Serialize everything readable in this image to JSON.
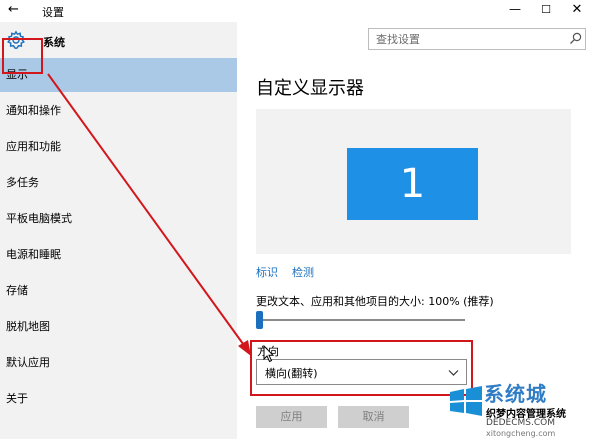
{
  "window": {
    "title": "设置",
    "back_glyph": "←",
    "minimize_glyph": "—",
    "maximize_glyph": "☐",
    "close_glyph": "✕"
  },
  "sidebar": {
    "title": "系统",
    "items": [
      {
        "label": "显示",
        "active": true
      },
      {
        "label": "通知和操作"
      },
      {
        "label": "应用和功能"
      },
      {
        "label": "多任务"
      },
      {
        "label": "平板电脑模式"
      },
      {
        "label": "电源和睡眠"
      },
      {
        "label": "存储"
      },
      {
        "label": "脱机地图"
      },
      {
        "label": "默认应用"
      },
      {
        "label": "关于"
      }
    ]
  },
  "search": {
    "placeholder": "查找设置"
  },
  "main": {
    "title": "自定义显示器",
    "monitor_number": "1",
    "links": {
      "identify": "标识",
      "detect": "检测"
    },
    "scale_label": "更改文本、应用和其他项目的大小: 100% (推荐)",
    "scale_value_percent": 0,
    "orientation": {
      "label": "方向",
      "selected": "横向(翻转)"
    },
    "buttons": {
      "apply": "应用",
      "cancel": "取消"
    }
  },
  "watermark": {
    "brand": "系统城",
    "tagline": "织梦内容管理系统",
    "url1": "DEDECMS.COM",
    "url2": "xitongcheng.com"
  },
  "colors": {
    "accent": "#1a6fbf",
    "active_item": "#a9c9e6",
    "monitor": "#1e90e6",
    "highlight": "#d2171c"
  }
}
